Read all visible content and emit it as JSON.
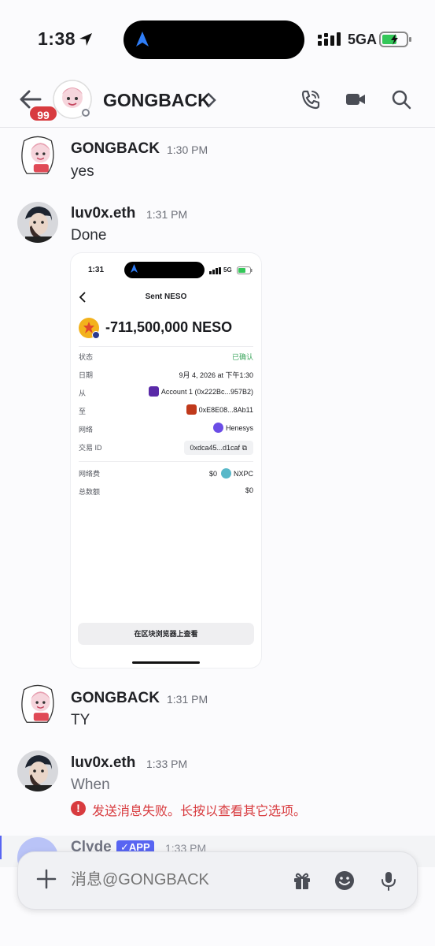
{
  "status": {
    "time": "1:38",
    "network": "5GA"
  },
  "header": {
    "badge": "99",
    "title": "GONGBACK"
  },
  "messages": [
    {
      "name": "GONGBACK",
      "time": "1:30 PM",
      "text": "yes"
    },
    {
      "name": "luv0x.eth",
      "time": "1:31 PM",
      "text": "Done"
    },
    {
      "name": "GONGBACK",
      "time": "1:31 PM",
      "text": "TY"
    },
    {
      "name": "luv0x.eth",
      "time": "1:33 PM",
      "text": "When",
      "error": "发送消息失败。长按以查看其它选项。"
    }
  ],
  "screenshot": {
    "time": "1:31",
    "network": "5G",
    "title": "Sent NESO",
    "amount": "-711,500,000 NESO",
    "rows": [
      {
        "label": "状态",
        "value": "已确认"
      },
      {
        "label": "日期",
        "value": "9月 4, 2026 at 下午1:30"
      },
      {
        "label": "从",
        "value": "Account 1 (0x222Bc...957B2)"
      },
      {
        "label": "至",
        "value": "0xE8E08...8Ab11"
      },
      {
        "label": "网络",
        "value": "Henesys"
      },
      {
        "label": "交易 ID",
        "value": "0xdca45...d1caf"
      }
    ],
    "fees": [
      {
        "label": "网络费",
        "value": "$0",
        "token": "NXPC"
      },
      {
        "label": "总数额",
        "value": "$0"
      }
    ],
    "button": "在区块浏览器上查看"
  },
  "clyde": {
    "name": "Clyde",
    "tag": "✓APP",
    "time": "1:33 PM"
  },
  "composer": {
    "placeholder": "消息@GONGBACK"
  }
}
